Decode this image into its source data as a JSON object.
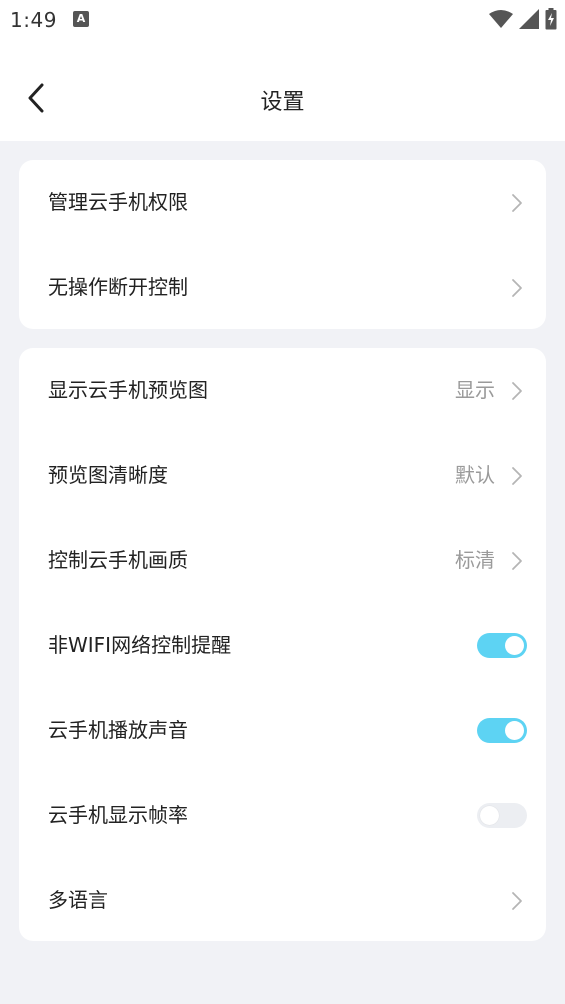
{
  "status_bar": {
    "time": "1:49",
    "notification_icon": "a-icon",
    "icons": [
      "wifi-icon",
      "signal-icon",
      "battery-charging-icon"
    ]
  },
  "header": {
    "back_icon": "chevron-left-icon",
    "title": "设置"
  },
  "group1": {
    "items": [
      {
        "label": "管理云手机权限",
        "type": "link"
      },
      {
        "label": "无操作断开控制",
        "type": "link"
      }
    ]
  },
  "group2": {
    "items": [
      {
        "label": "显示云手机预览图",
        "value": "显示",
        "type": "select"
      },
      {
        "label": "预览图清晰度",
        "value": "默认",
        "type": "select"
      },
      {
        "label": "控制云手机画质",
        "value": "标清",
        "type": "select"
      },
      {
        "label": "非WIFI网络控制提醒",
        "type": "toggle",
        "on": true
      },
      {
        "label": "云手机播放声音",
        "type": "toggle",
        "on": true
      },
      {
        "label": "云手机显示帧率",
        "type": "toggle",
        "on": false
      },
      {
        "label": "多语言",
        "type": "link"
      }
    ]
  },
  "colors": {
    "background": "#f1f2f6",
    "card": "#ffffff",
    "toggle_on": "#5dd3f3",
    "toggle_off": "#eceef2",
    "value_text": "#9a9a9a"
  }
}
